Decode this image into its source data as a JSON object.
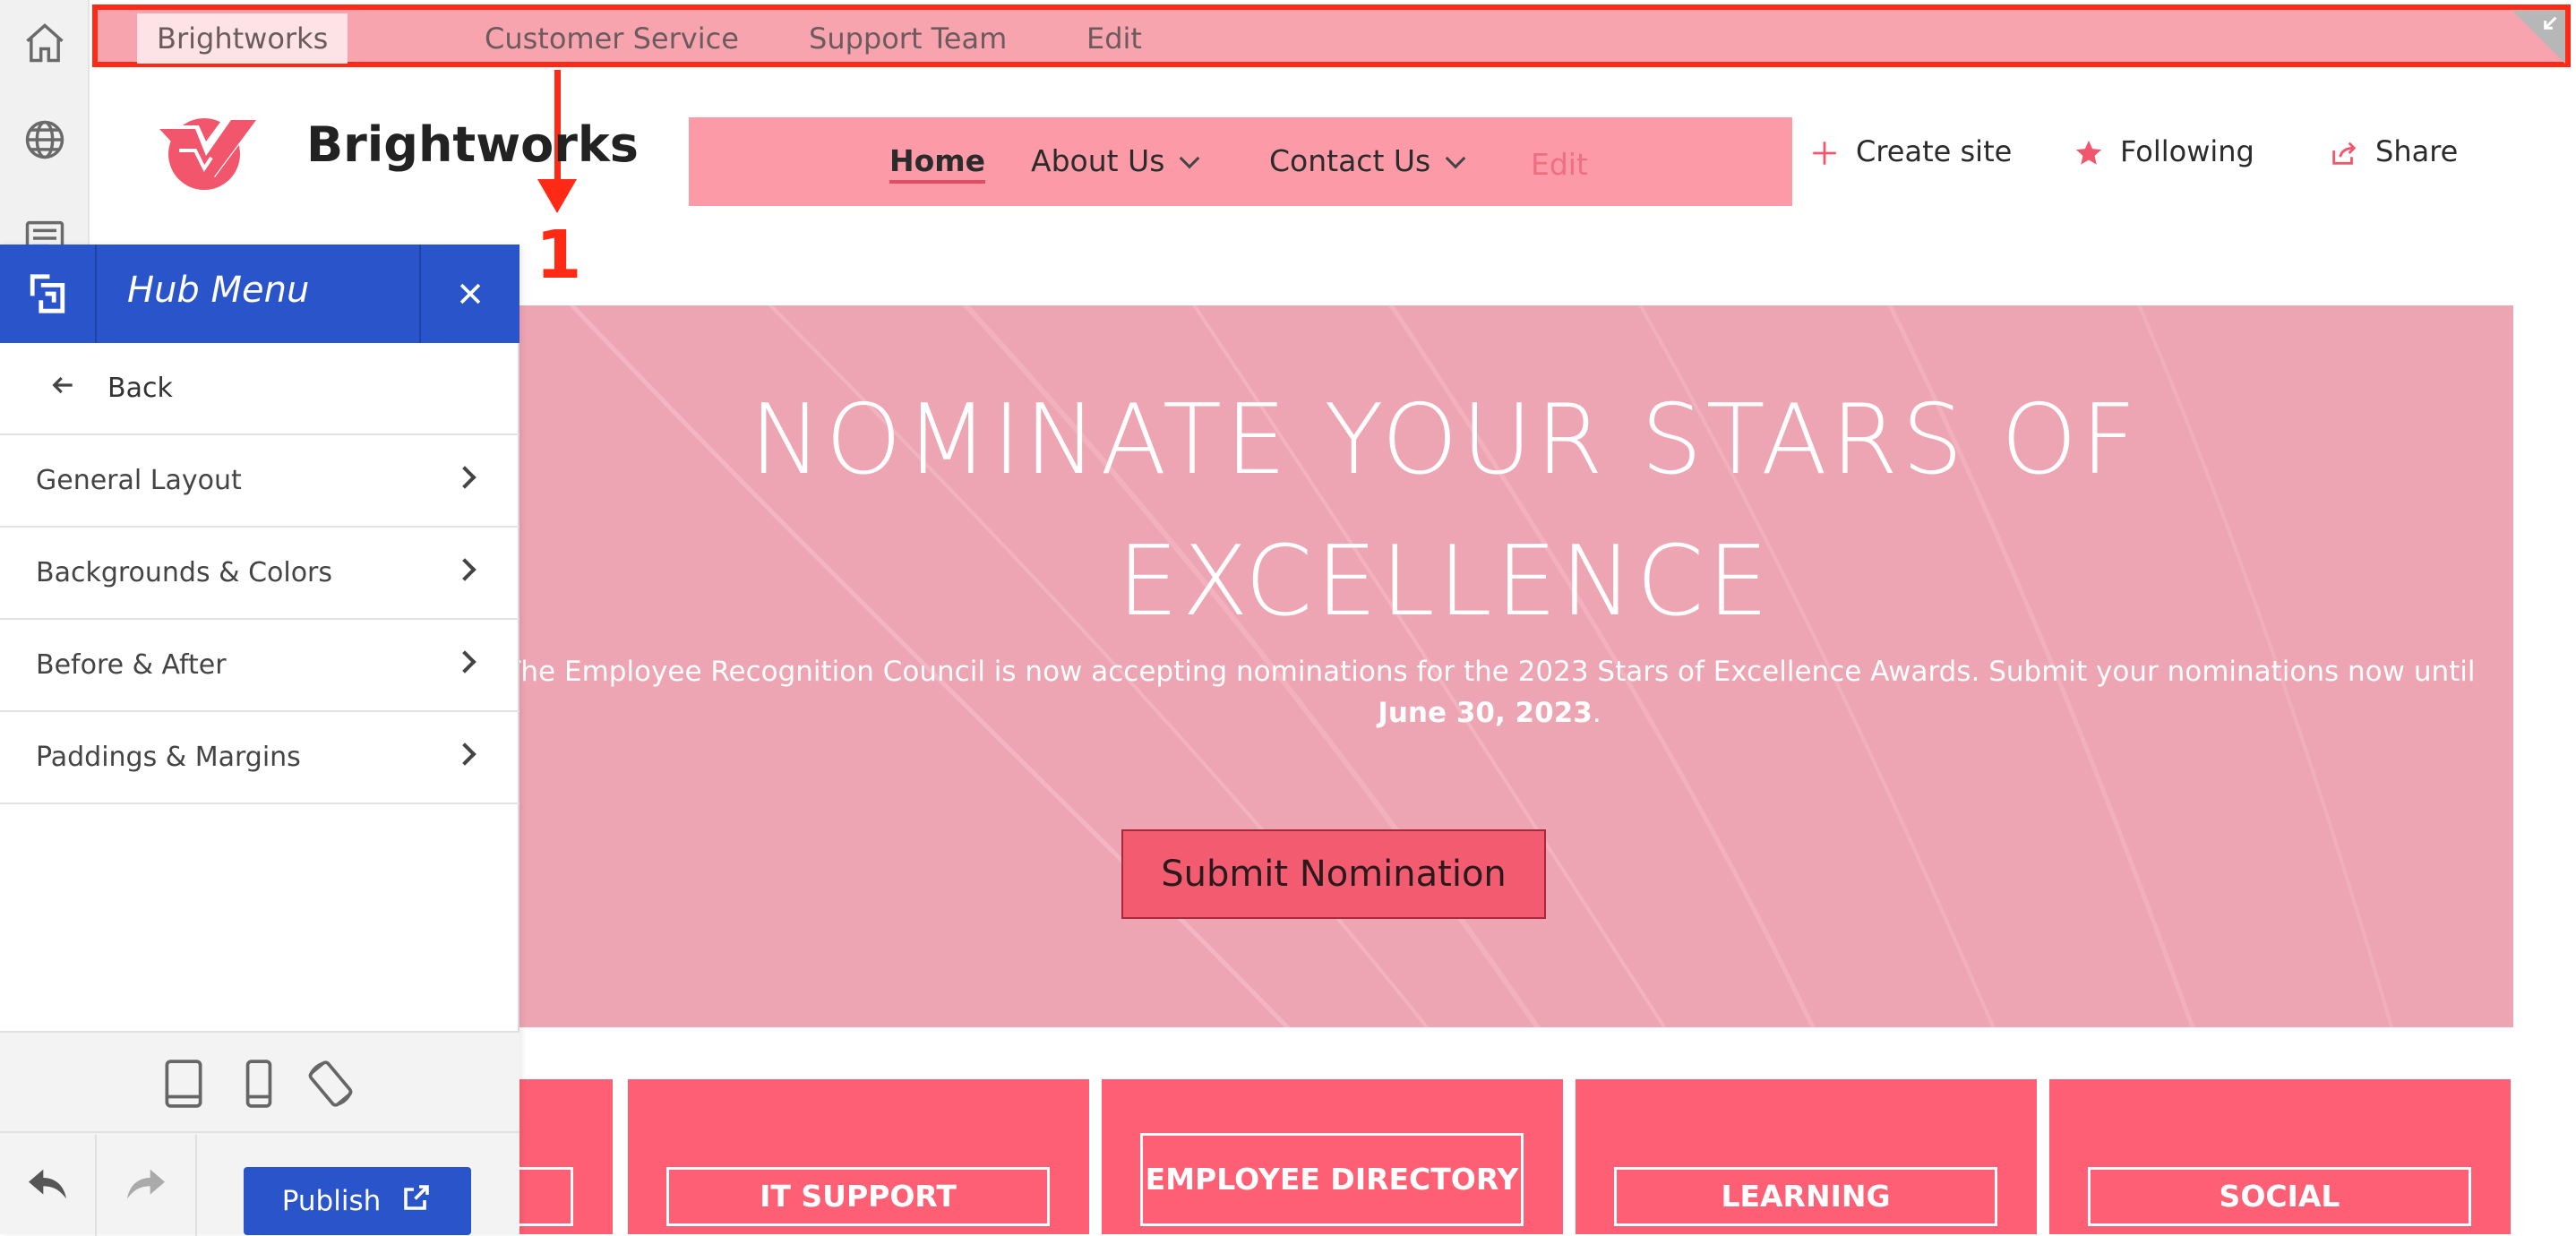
{
  "top_nav": {
    "items": [
      "Brightworks",
      "Customer Service",
      "Support Team",
      "Edit"
    ]
  },
  "annotation": {
    "label": "1"
  },
  "site": {
    "title": "Brightworks"
  },
  "main_nav": {
    "home": "Home",
    "about": "About Us",
    "contact": "Contact Us",
    "edit": "Edit"
  },
  "actions": {
    "create_site": "Create site",
    "following": "Following",
    "share": "Share"
  },
  "hero": {
    "title_line1": "NOMINATE YOUR STARS OF",
    "title_line2": "EXCELLENCE",
    "text_part1": "The Employee Recognition Council is now accepting nominations for the 2023 Stars of Excellence Awards. Submit your nominations now until",
    "text_bold": "June 30, 2023",
    "text_end": ".",
    "button": "Submit Nomination"
  },
  "tiles": [
    "",
    "IT SUPPORT",
    "EMPLOYEE DIRECTORY",
    "LEARNING",
    "SOCIAL"
  ],
  "panel": {
    "title": "Hub Menu",
    "back": "Back",
    "items": [
      "General Layout",
      "Backgrounds & Colors",
      "Before & After",
      "Paddings & Margins"
    ],
    "publish": "Publish"
  },
  "colors": {
    "accent_blue": "#2a54c9",
    "brand_pink": "#fe5f74",
    "annotation_red": "#ff2a16"
  },
  "icons": {
    "rail": [
      "home-icon",
      "globe-icon",
      "news-icon"
    ],
    "actions": [
      "plus-icon",
      "star-icon",
      "share-icon"
    ],
    "devices": [
      "tablet-icon",
      "phone-icon",
      "rotate-icon"
    ]
  }
}
